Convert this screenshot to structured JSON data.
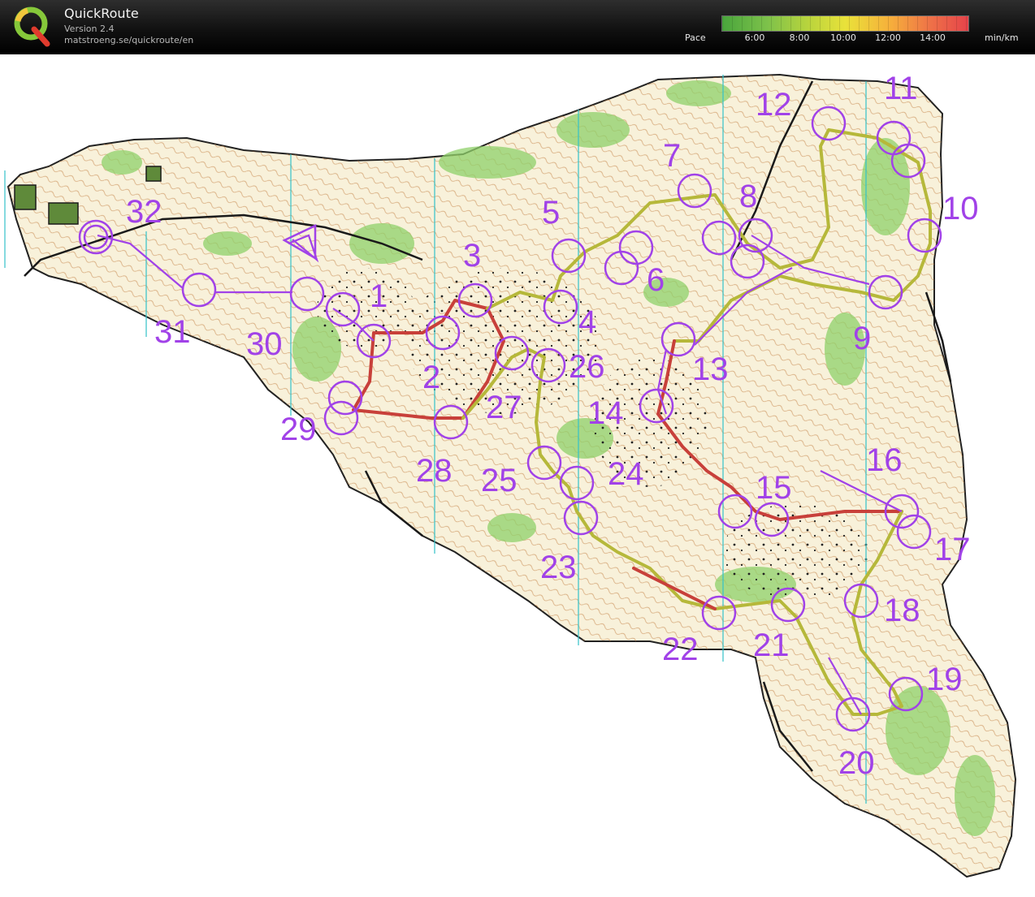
{
  "header": {
    "app_title": "QuickRoute",
    "version": "Version 2.4",
    "url": "matstroeng.se/quickroute/en",
    "pace_label": "Pace",
    "pace_ticks": [
      "6:00",
      "8:00",
      "10:00",
      "12:00",
      "14:00"
    ],
    "pace_unit": "min/km"
  },
  "controls": [
    "1",
    "2",
    "3",
    "4",
    "5",
    "6",
    "7",
    "8",
    "9",
    "10",
    "11",
    "12",
    "13",
    "14",
    "15",
    "16",
    "17",
    "18",
    "19",
    "20",
    "21",
    "22",
    "23",
    "24",
    "25",
    "26",
    "27",
    "28",
    "29",
    "30",
    "31",
    "32"
  ],
  "colors": {
    "course": "#a142e8",
    "route_slow": "#d03a3a",
    "route_fast": "#b6b83a",
    "terrain": "#f7f0d8",
    "vegetation": "#8fd06a",
    "contour": "#b8743a"
  }
}
